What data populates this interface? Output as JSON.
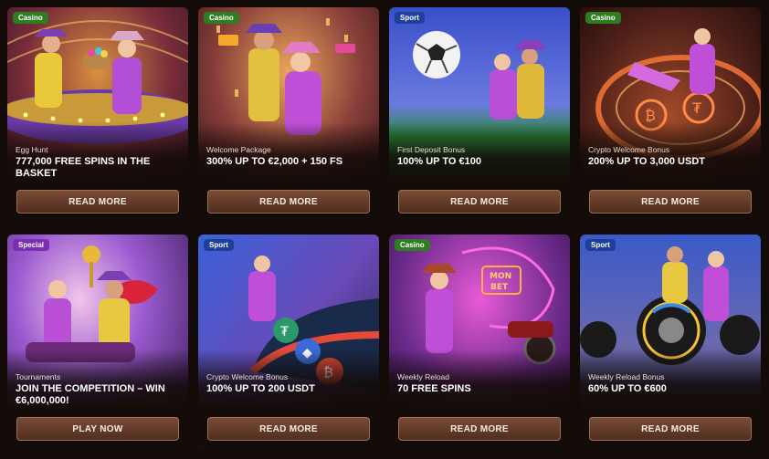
{
  "cards": [
    {
      "badge": "Casino",
      "subtitle": "Egg Hunt",
      "title": "777,000 FREE SPINS IN THE BASKET",
      "button": "READ MORE"
    },
    {
      "badge": "Casino",
      "subtitle": "Welcome Package",
      "title": "300% UP TO €2,000 + 150 FS",
      "button": "READ MORE"
    },
    {
      "badge": "Sport",
      "subtitle": "First Deposit Bonus",
      "title": "100% UP TO €100",
      "button": "READ MORE"
    },
    {
      "badge": "Casino",
      "subtitle": "Crypto Welcome Bonus",
      "title": "200% UP TO 3,000 USDT",
      "button": "READ MORE"
    },
    {
      "badge": "Special",
      "subtitle": "Tournaments",
      "title": "JOIN THE COMPETITION – WIN €6,000,000!",
      "button": "PLAY NOW"
    },
    {
      "badge": "Sport",
      "subtitle": "Crypto Welcome Bonus",
      "title": "100% UP TO 200 USDT",
      "button": "READ MORE"
    },
    {
      "badge": "Casino",
      "subtitle": "Weekly Reload",
      "title": "70 FREE SPINS",
      "button": "READ MORE"
    },
    {
      "badge": "Sport",
      "subtitle": "Weekly Reload Bonus",
      "title": "60% UP TO €600",
      "button": "READ MORE"
    }
  ],
  "art_text": {
    "neon_sign": "MON",
    "neon_sign2": "BET"
  },
  "colors": {
    "casino_badge": "#2f7d21",
    "sport_badge": "#1f3f9a",
    "special_badge": "#7a2fb3",
    "button": "#6a4030",
    "background": "#120b07"
  }
}
